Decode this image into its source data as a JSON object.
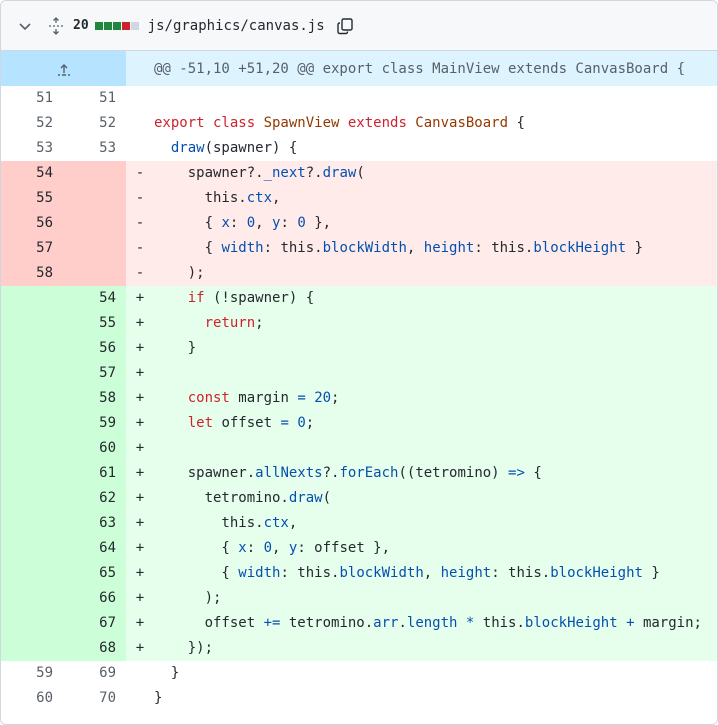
{
  "file_header": {
    "change_count": "20",
    "path": "js/graphics/canvas.js",
    "diffstat_colors": [
      "#1f883d",
      "#1f883d",
      "#1f883d",
      "#cf222e",
      "#d0d7de"
    ]
  },
  "hunk": {
    "header": "@@ -51,10 +51,20 @@ export class MainView extends CanvasBoard {"
  },
  "colors": {
    "keyword": "#cf222e",
    "class_name": "#953800",
    "property": "#0550ae",
    "added_bg": "#e6ffec",
    "deleted_bg": "#ffebe9"
  },
  "icons": {
    "collapse": "chevron-down-icon",
    "expand_all": "unfold-icon",
    "copy": "copy-icon",
    "expand_up": "expand-up-icon"
  },
  "lines": [
    {
      "type": "ctx",
      "old": "51",
      "new": "51",
      "sign": "",
      "tokens": []
    },
    {
      "type": "ctx",
      "old": "52",
      "new": "52",
      "sign": "",
      "tokens": [
        [
          "kw",
          "export class "
        ],
        [
          "cls",
          "SpawnView"
        ],
        [
          "kw",
          " extends "
        ],
        [
          "cls",
          "CanvasBoard"
        ],
        [
          "plain",
          " {"
        ]
      ]
    },
    {
      "type": "ctx",
      "old": "53",
      "new": "53",
      "sign": "",
      "tokens": [
        [
          "plain",
          "  "
        ],
        [
          "prop",
          "draw"
        ],
        [
          "plain",
          "(spawner) {"
        ]
      ]
    },
    {
      "type": "del",
      "old": "54",
      "new": "",
      "sign": "-",
      "tokens": [
        [
          "plain",
          "    spawner?."
        ],
        [
          "prop",
          "_next"
        ],
        [
          "plain",
          "?."
        ],
        [
          "prop",
          "draw"
        ],
        [
          "plain",
          "("
        ]
      ]
    },
    {
      "type": "del",
      "old": "55",
      "new": "",
      "sign": "-",
      "tokens": [
        [
          "plain",
          "      this."
        ],
        [
          "prop",
          "ctx"
        ],
        [
          "plain",
          ","
        ]
      ]
    },
    {
      "type": "del",
      "old": "56",
      "new": "",
      "sign": "-",
      "tokens": [
        [
          "plain",
          "      { "
        ],
        [
          "prop",
          "x"
        ],
        [
          "plain",
          ": "
        ],
        [
          "num",
          "0"
        ],
        [
          "plain",
          ", "
        ],
        [
          "prop",
          "y"
        ],
        [
          "plain",
          ": "
        ],
        [
          "num",
          "0"
        ],
        [
          "plain",
          " },"
        ]
      ]
    },
    {
      "type": "del",
      "old": "57",
      "new": "",
      "sign": "-",
      "tokens": [
        [
          "plain",
          "      { "
        ],
        [
          "prop",
          "width"
        ],
        [
          "plain",
          ": this."
        ],
        [
          "prop",
          "blockWidth"
        ],
        [
          "plain",
          ", "
        ],
        [
          "prop",
          "height"
        ],
        [
          "plain",
          ": this."
        ],
        [
          "prop",
          "blockHeight"
        ],
        [
          "plain",
          " }"
        ]
      ]
    },
    {
      "type": "del",
      "old": "58",
      "new": "",
      "sign": "-",
      "tokens": [
        [
          "plain",
          "    );"
        ]
      ]
    },
    {
      "type": "add",
      "old": "",
      "new": "54",
      "sign": "+",
      "tokens": [
        [
          "plain",
          "    "
        ],
        [
          "kw",
          "if"
        ],
        [
          "plain",
          " (!spawner) {"
        ]
      ]
    },
    {
      "type": "add",
      "old": "",
      "new": "55",
      "sign": "+",
      "tokens": [
        [
          "plain",
          "      "
        ],
        [
          "kw",
          "return"
        ],
        [
          "plain",
          ";"
        ]
      ]
    },
    {
      "type": "add",
      "old": "",
      "new": "56",
      "sign": "+",
      "tokens": [
        [
          "plain",
          "    }"
        ]
      ]
    },
    {
      "type": "add",
      "old": "",
      "new": "57",
      "sign": "+",
      "tokens": []
    },
    {
      "type": "add",
      "old": "",
      "new": "58",
      "sign": "+",
      "tokens": [
        [
          "plain",
          "    "
        ],
        [
          "kw",
          "const"
        ],
        [
          "plain",
          " margin "
        ],
        [
          "op",
          "="
        ],
        [
          "plain",
          " "
        ],
        [
          "num",
          "20"
        ],
        [
          "plain",
          ";"
        ]
      ]
    },
    {
      "type": "add",
      "old": "",
      "new": "59",
      "sign": "+",
      "tokens": [
        [
          "plain",
          "    "
        ],
        [
          "kw",
          "let"
        ],
        [
          "plain",
          " offset "
        ],
        [
          "op",
          "="
        ],
        [
          "plain",
          " "
        ],
        [
          "num",
          "0"
        ],
        [
          "plain",
          ";"
        ]
      ]
    },
    {
      "type": "add",
      "old": "",
      "new": "60",
      "sign": "+",
      "tokens": []
    },
    {
      "type": "add",
      "old": "",
      "new": "61",
      "sign": "+",
      "tokens": [
        [
          "plain",
          "    spawner."
        ],
        [
          "prop",
          "allNexts"
        ],
        [
          "plain",
          "?."
        ],
        [
          "prop",
          "forEach"
        ],
        [
          "plain",
          "((tetromino) "
        ],
        [
          "op",
          "=>"
        ],
        [
          "plain",
          " {"
        ]
      ]
    },
    {
      "type": "add",
      "old": "",
      "new": "62",
      "sign": "+",
      "tokens": [
        [
          "plain",
          "      tetromino."
        ],
        [
          "prop",
          "draw"
        ],
        [
          "plain",
          "("
        ]
      ]
    },
    {
      "type": "add",
      "old": "",
      "new": "63",
      "sign": "+",
      "tokens": [
        [
          "plain",
          "        this."
        ],
        [
          "prop",
          "ctx"
        ],
        [
          "plain",
          ","
        ]
      ]
    },
    {
      "type": "add",
      "old": "",
      "new": "64",
      "sign": "+",
      "tokens": [
        [
          "plain",
          "        { "
        ],
        [
          "prop",
          "x"
        ],
        [
          "plain",
          ": "
        ],
        [
          "num",
          "0"
        ],
        [
          "plain",
          ", "
        ],
        [
          "prop",
          "y"
        ],
        [
          "plain",
          ": offset },"
        ]
      ]
    },
    {
      "type": "add",
      "old": "",
      "new": "65",
      "sign": "+",
      "tokens": [
        [
          "plain",
          "        { "
        ],
        [
          "prop",
          "width"
        ],
        [
          "plain",
          ": this."
        ],
        [
          "prop",
          "blockWidth"
        ],
        [
          "plain",
          ", "
        ],
        [
          "prop",
          "height"
        ],
        [
          "plain",
          ": this."
        ],
        [
          "prop",
          "blockHeight"
        ],
        [
          "plain",
          " }"
        ]
      ]
    },
    {
      "type": "add",
      "old": "",
      "new": "66",
      "sign": "+",
      "tokens": [
        [
          "plain",
          "      );"
        ]
      ]
    },
    {
      "type": "add",
      "old": "",
      "new": "67",
      "sign": "+",
      "tokens": [
        [
          "plain",
          "      offset "
        ],
        [
          "op",
          "+="
        ],
        [
          "plain",
          " tetromino."
        ],
        [
          "prop",
          "arr"
        ],
        [
          "plain",
          "."
        ],
        [
          "prop",
          "length"
        ],
        [
          "plain",
          " "
        ],
        [
          "op",
          "*"
        ],
        [
          "plain",
          " this."
        ],
        [
          "prop",
          "blockHeight"
        ],
        [
          "plain",
          " "
        ],
        [
          "op",
          "+"
        ],
        [
          "plain",
          " margin;"
        ]
      ]
    },
    {
      "type": "add",
      "old": "",
      "new": "68",
      "sign": "+",
      "tokens": [
        [
          "plain",
          "    });"
        ]
      ]
    },
    {
      "type": "ctx",
      "old": "59",
      "new": "69",
      "sign": "",
      "tokens": [
        [
          "plain",
          "  }"
        ]
      ]
    },
    {
      "type": "ctx",
      "old": "60",
      "new": "70",
      "sign": "",
      "tokens": [
        [
          "plain",
          "}"
        ]
      ]
    }
  ]
}
